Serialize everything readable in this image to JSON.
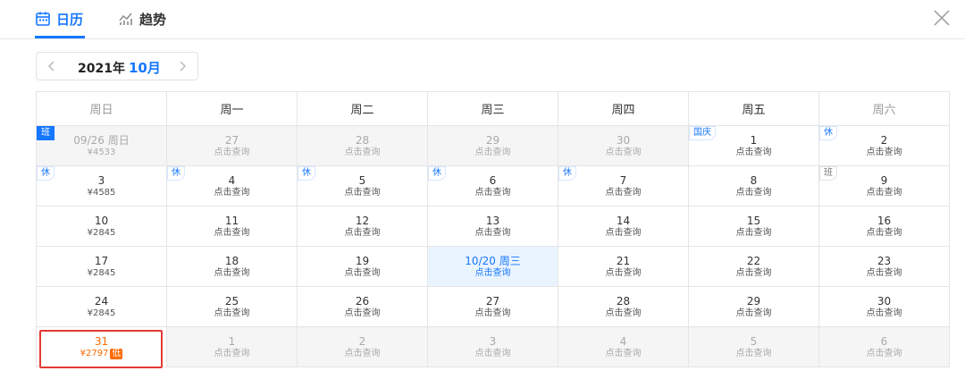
{
  "tabs": [
    {
      "label": "日历",
      "icon": "calendar-icon",
      "active": true
    },
    {
      "label": "趋势",
      "icon": "trend-chart-icon",
      "active": false
    }
  ],
  "month": {
    "year_label": "2021年",
    "month_label": "10月"
  },
  "weekdays": [
    "周日",
    "周一",
    "周二",
    "周三",
    "周四",
    "周五",
    "周六"
  ],
  "weeks": [
    [
      {
        "day": "09/26 周日",
        "sub": "¥4533",
        "state": "grey",
        "tag": "班",
        "tag_style": "solid"
      },
      {
        "day": "27",
        "sub": "点击查询",
        "state": "grey"
      },
      {
        "day": "28",
        "sub": "点击查询",
        "state": "grey"
      },
      {
        "day": "29",
        "sub": "点击查询",
        "state": "grey"
      },
      {
        "day": "30",
        "sub": "点击查询",
        "state": "grey"
      },
      {
        "day": "1",
        "sub": "点击查询",
        "tag": "国庆",
        "tag_style": "blue"
      },
      {
        "day": "2",
        "sub": "点击查询",
        "tag": "休",
        "tag_style": "blue"
      }
    ],
    [
      {
        "day": "3",
        "sub": "¥4585",
        "tag": "休",
        "tag_style": "blue"
      },
      {
        "day": "4",
        "sub": "点击查询",
        "tag": "休",
        "tag_style": "blue"
      },
      {
        "day": "5",
        "sub": "点击查询",
        "tag": "休",
        "tag_style": "blue"
      },
      {
        "day": "6",
        "sub": "点击查询",
        "tag": "休",
        "tag_style": "blue"
      },
      {
        "day": "7",
        "sub": "点击查询",
        "tag": "休",
        "tag_style": "blue"
      },
      {
        "day": "8",
        "sub": "点击查询"
      },
      {
        "day": "9",
        "sub": "点击查询",
        "tag": "班",
        "tag_style": "gray"
      }
    ],
    [
      {
        "day": "10",
        "sub": "¥2845"
      },
      {
        "day": "11",
        "sub": "点击查询"
      },
      {
        "day": "12",
        "sub": "点击查询"
      },
      {
        "day": "13",
        "sub": "点击查询"
      },
      {
        "day": "14",
        "sub": "点击查询"
      },
      {
        "day": "15",
        "sub": "点击查询"
      },
      {
        "day": "16",
        "sub": "点击查询"
      }
    ],
    [
      {
        "day": "17",
        "sub": "¥2845"
      },
      {
        "day": "18",
        "sub": "点击查询"
      },
      {
        "day": "19",
        "sub": "点击查询"
      },
      {
        "day": "10/20 周三",
        "sub": "点击查询",
        "state": "sel"
      },
      {
        "day": "21",
        "sub": "点击查询"
      },
      {
        "day": "22",
        "sub": "点击查询"
      },
      {
        "day": "23",
        "sub": "点击查询"
      }
    ],
    [
      {
        "day": "24",
        "sub": "¥2845"
      },
      {
        "day": "25",
        "sub": "点击查询"
      },
      {
        "day": "26",
        "sub": "点击查询"
      },
      {
        "day": "27",
        "sub": "点击查询"
      },
      {
        "day": "28",
        "sub": "点击查询"
      },
      {
        "day": "29",
        "sub": "点击查询"
      },
      {
        "day": "30",
        "sub": "点击查询"
      }
    ],
    [
      {
        "day": "31",
        "sub": "¥2797",
        "state": "low",
        "low_label": "低"
      },
      {
        "day": "1",
        "sub": "点击查询",
        "state": "grey"
      },
      {
        "day": "2",
        "sub": "点击查询",
        "state": "grey"
      },
      {
        "day": "3",
        "sub": "点击查询",
        "state": "grey"
      },
      {
        "day": "4",
        "sub": "点击查询",
        "state": "grey"
      },
      {
        "day": "5",
        "sub": "点击查询",
        "state": "grey"
      },
      {
        "day": "6",
        "sub": "点击查询",
        "state": "grey"
      }
    ]
  ],
  "colors": {
    "accent": "#1677ff",
    "low_price": "#ff6a00",
    "highlight_box": "#e53935"
  }
}
